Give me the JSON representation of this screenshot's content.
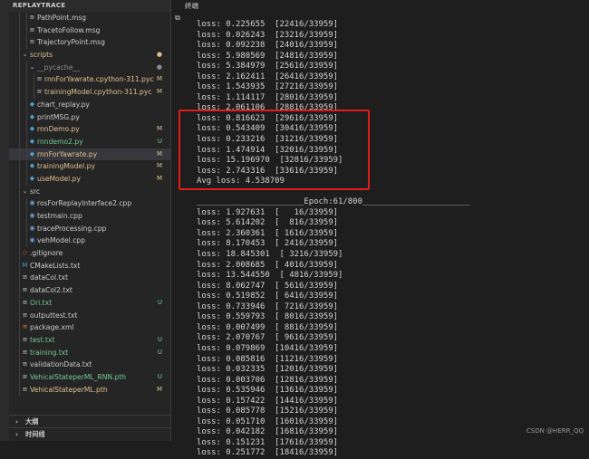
{
  "sidebar": {
    "title": "REPLAYTRACE",
    "items": [
      {
        "label": "PathPoint.msg",
        "icon": "list-icon",
        "status": "",
        "color": "default",
        "indent": 3,
        "guides": [
          1,
          2
        ]
      },
      {
        "label": "TracetoFollow.msg",
        "icon": "list-icon",
        "status": "",
        "color": "default",
        "indent": 3,
        "guides": [
          1,
          2
        ]
      },
      {
        "label": "TrajectoryPoint.msg",
        "icon": "list-icon",
        "status": "",
        "color": "default",
        "indent": 3,
        "guides": [
          1,
          2
        ]
      },
      {
        "label": "scripts",
        "icon": "chevron-down-icon",
        "status": "●",
        "color": "mod",
        "indent": 2,
        "guides": [
          1
        ]
      },
      {
        "label": "__pycache__",
        "icon": "chevron-down-icon",
        "status": "●",
        "color": "gray",
        "indent": 3,
        "guides": [
          1,
          2
        ]
      },
      {
        "label": "rnnForYawrate.cpython-311.pyc",
        "icon": "list-icon",
        "status": "M",
        "color": "mod",
        "indent": 4,
        "guides": [
          1,
          2,
          3
        ]
      },
      {
        "label": "trainingModel.cpython-311.pyc",
        "icon": "list-icon",
        "status": "M",
        "color": "mod",
        "indent": 4,
        "guides": [
          1,
          2,
          3
        ]
      },
      {
        "label": "chart_replay.py",
        "icon": "python-icon",
        "status": "",
        "color": "default",
        "indent": 3,
        "guides": [
          1,
          2
        ]
      },
      {
        "label": "printMSG.py",
        "icon": "python-icon",
        "status": "",
        "color": "default",
        "indent": 3,
        "guides": [
          1,
          2
        ]
      },
      {
        "label": "rnnDemo.py",
        "icon": "python-icon",
        "status": "M",
        "color": "mod",
        "indent": 3,
        "guides": [
          1,
          2
        ]
      },
      {
        "label": "rnndemo2.py",
        "icon": "python-icon",
        "status": "U",
        "color": "new",
        "indent": 3,
        "guides": [
          1,
          2
        ]
      },
      {
        "label": "rnnForYawrate.py",
        "icon": "python-icon",
        "status": "M",
        "color": "mod",
        "indent": 3,
        "guides": [
          1,
          2
        ],
        "selected": true
      },
      {
        "label": "trainingModel.py",
        "icon": "python-icon",
        "status": "M",
        "color": "mod",
        "indent": 3,
        "guides": [
          1,
          2
        ]
      },
      {
        "label": "useModel.py",
        "icon": "python-icon",
        "status": "M",
        "color": "mod",
        "indent": 3,
        "guides": [
          1,
          2
        ]
      },
      {
        "label": "src",
        "icon": "chevron-down-icon",
        "status": "",
        "color": "default",
        "indent": 2,
        "guides": [
          1
        ]
      },
      {
        "label": "rosForReplayInterface2.cpp",
        "icon": "cpp-icon",
        "status": "",
        "color": "default",
        "indent": 3,
        "guides": [
          1,
          2
        ]
      },
      {
        "label": "testmain.cpp",
        "icon": "cpp-icon",
        "status": "",
        "color": "default",
        "indent": 3,
        "guides": [
          1,
          2
        ]
      },
      {
        "label": "traceProcessing.cpp",
        "icon": "cpp-icon",
        "status": "",
        "color": "default",
        "indent": 3,
        "guides": [
          1,
          2
        ]
      },
      {
        "label": "vehModel.cpp",
        "icon": "cpp-icon",
        "status": "",
        "color": "default",
        "indent": 3,
        "guides": [
          1,
          2
        ]
      },
      {
        "label": ".gitignore",
        "icon": "git-icon",
        "status": "",
        "color": "default",
        "indent": 2,
        "guides": [
          1
        ]
      },
      {
        "label": "CMakeLists.txt",
        "icon": "cmake-icon",
        "status": "",
        "color": "default",
        "indent": 2,
        "guides": [
          1
        ]
      },
      {
        "label": "dataCol.txt",
        "icon": "list-icon",
        "status": "",
        "color": "default",
        "indent": 2,
        "guides": [
          1
        ]
      },
      {
        "label": "dataCol2.txt",
        "icon": "list-icon",
        "status": "",
        "color": "default",
        "indent": 2,
        "guides": [
          1
        ]
      },
      {
        "label": "Ori.txt",
        "icon": "list-icon",
        "status": "U",
        "color": "new",
        "indent": 2,
        "guides": [
          1
        ]
      },
      {
        "label": "outputtest.txt",
        "icon": "list-icon",
        "status": "",
        "color": "default",
        "indent": 2,
        "guides": [
          1
        ]
      },
      {
        "label": "package.xml",
        "icon": "rss-icon",
        "status": "",
        "color": "default",
        "indent": 2,
        "guides": [
          1
        ]
      },
      {
        "label": "test.txt",
        "icon": "list-icon",
        "status": "U",
        "color": "new",
        "indent": 2,
        "guides": [
          1
        ]
      },
      {
        "label": "training.txt",
        "icon": "list-icon",
        "status": "U",
        "color": "new",
        "indent": 2,
        "guides": [
          1
        ]
      },
      {
        "label": "validationData.txt",
        "icon": "list-icon",
        "status": "",
        "color": "default",
        "indent": 2,
        "guides": [
          1
        ]
      },
      {
        "label": "VehicalStateperML_RNN.pth",
        "icon": "list-icon",
        "status": "U",
        "color": "new",
        "indent": 2,
        "guides": [
          1
        ]
      },
      {
        "label": "VehicalStateperML.pth",
        "icon": "list-icon",
        "status": "M",
        "color": "mod",
        "indent": 2,
        "guides": [
          1
        ]
      }
    ],
    "outline_label": "大纲",
    "timeline_label": "时间线"
  },
  "terminal": {
    "tab_label": "终端",
    "lines": [
      "loss: 0.225655  [22416/33959]",
      "loss: 0.026243  [23216/33959]",
      "loss: 0.092238  [24016/33959]",
      "loss: 5.980569  [24816/33959]",
      "loss: 5.384979  [25616/33959]",
      "loss: 2.162411  [26416/33959]",
      "loss: 1.543935  [27216/33959]",
      "loss: 1.114117  [28016/33959]",
      "loss: 2.061106  [28816/33959]",
      "loss: 0.816623  [29616/33959]",
      "loss: 0.543409  [30416/33959]",
      "loss: 0.233216  [31216/33959]",
      "loss: 1.474914  [32016/33959]",
      "loss: 15.196970  [32816/33959]",
      "loss: 2.743316  [33616/33959]",
      "Avg loss: 4.538709",
      "",
      "______________________Epoch:61/800______________________",
      "loss: 1.927631  [   16/33959]",
      "loss: 5.614202  [  816/33959]",
      "loss: 2.360361  [ 1616/33959]",
      "loss: 8.170453  [ 2416/33959]",
      "loss: 18.845301  [ 3216/33959]",
      "loss: 2.008685  [ 4016/33959]",
      "loss: 13.544550  [ 4816/33959]",
      "loss: 8.062747  [ 5616/33959]",
      "loss: 0.519852  [ 6416/33959]",
      "loss: 0.733946  [ 7216/33959]",
      "loss: 0.559793  [ 8016/33959]",
      "loss: 0.007499  [ 8816/33959]",
      "loss: 2.070767  [ 9616/33959]",
      "loss: 0.079869  [10416/33959]",
      "loss: 0.085816  [11216/33959]",
      "loss: 0.032335  [12016/33959]",
      "loss: 0.003706  [12816/33959]",
      "loss: 0.535946  [13616/33959]",
      "loss: 0.157422  [14416/33959]",
      "loss: 0.085778  [15216/33959]",
      "loss: 0.051710  [16016/33959]",
      "loss: 0.042182  [16816/33959]",
      "loss: 0.151231  [17616/33959]",
      "loss: 0.251772  [18416/33959]"
    ]
  },
  "watermark": "CSDN @HERR_QQ",
  "colors": {
    "modified": "#e2c08d",
    "untracked": "#73c991",
    "highlight": "#e01c1c",
    "python": "#4f9fd1",
    "cpp": "#6a9bd1"
  }
}
